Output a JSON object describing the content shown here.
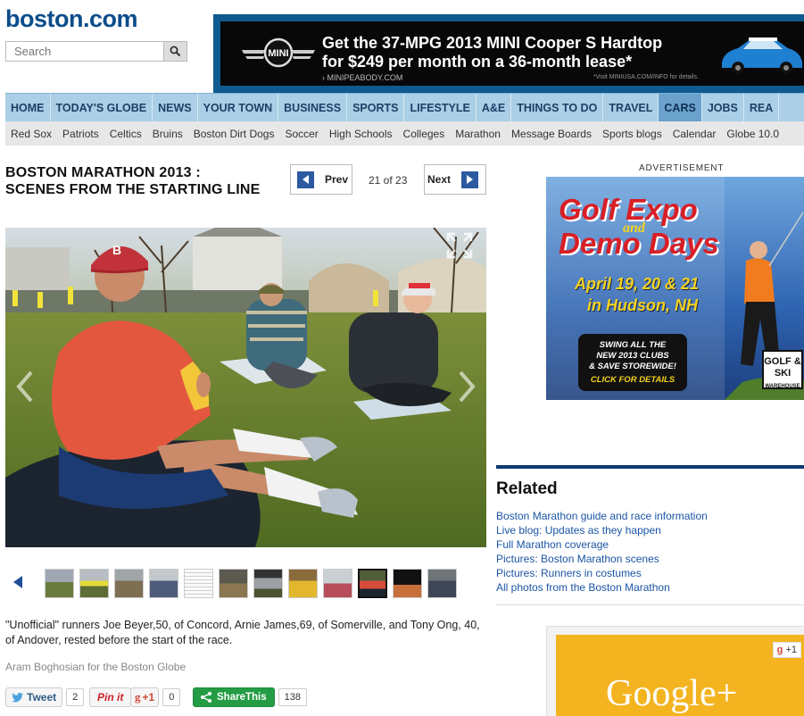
{
  "site": {
    "logo": "boston.com"
  },
  "search": {
    "placeholder": "Search"
  },
  "top_ad": {
    "headline_1": "Get the 37-MPG 2013 MINI Cooper S Hardtop",
    "headline_2": "for $249 per month on a 36-month lease*",
    "link": "MINIPEABODY.COM",
    "legal": "*Visit MINIUSA.COM/INFO for details.",
    "brand": "MINI"
  },
  "nav": {
    "items": [
      "HOME",
      "TODAY'S GLOBE",
      "NEWS",
      "YOUR TOWN",
      "BUSINESS",
      "SPORTS",
      "LIFESTYLE",
      "A&E",
      "THINGS TO DO",
      "TRAVEL",
      "CARS",
      "JOBS",
      "REA"
    ],
    "active_index": 10
  },
  "subnav": {
    "items": [
      "Red Sox",
      "Patriots",
      "Celtics",
      "Bruins",
      "Boston Dirt Dogs",
      "Soccer",
      "High Schools",
      "Colleges",
      "Marathon",
      "Message Boards",
      "Sports blogs",
      "Calendar",
      "Globe 10.0"
    ]
  },
  "gallery": {
    "title_line1": "BOSTON MARATHON 2013 :",
    "title_line2": "SCENES FROM THE STARTING LINE",
    "prev_label": "Prev",
    "next_label": "Next",
    "counter": "21 of 23",
    "caption": "\"Unofficial\" runners Joe Beyer,50, of Concord, Arnie James,69, of Somerville, and Tony Ong, 40, of Andover, rested before the start of the race.",
    "credit": "Aram Boghosian for the Boston Globe",
    "thumb_count": 12,
    "selected_thumb": 9
  },
  "share": {
    "tweet_label": "Tweet",
    "tweet_count": "2",
    "pinit_label": "Pin it",
    "gplus_label": "+1",
    "gplus_count": "0",
    "sharethis_label": "ShareThis",
    "sharethis_count": "138"
  },
  "advertisement_label": "ADVERTISEMENT",
  "golf_ad": {
    "title_1": "Golf Expo",
    "title_and": "and",
    "title_2": "Demo Days",
    "date_1": "April 19, 20 & 21",
    "date_2": "in Hudson, NH",
    "cta_1": "SWING ALL THE",
    "cta_2": "NEW 2013 CLUBS",
    "cta_3": "& SAVE STOREWIDE!",
    "cta_4": "CLICK FOR DETAILS",
    "logo": "GOLF & SKI",
    "logo_sub": "WAREHOUSE"
  },
  "related": {
    "title": "Related",
    "links": [
      "Boston Marathon guide and race information",
      "Live blog: Updates as they happen",
      "Full Marathon coverage",
      "Pictures: Boston Marathon scenes",
      "Pictures: Runners in costumes",
      "All photos from the Boston Marathon"
    ]
  },
  "gplus_ad": {
    "word": "Google+",
    "badge": "+1"
  },
  "colors": {
    "brand_blue": "#0b4d8b",
    "nav_bg": "#aacfe6",
    "link": "#1b55a5",
    "accent_red": "#d81f26"
  }
}
